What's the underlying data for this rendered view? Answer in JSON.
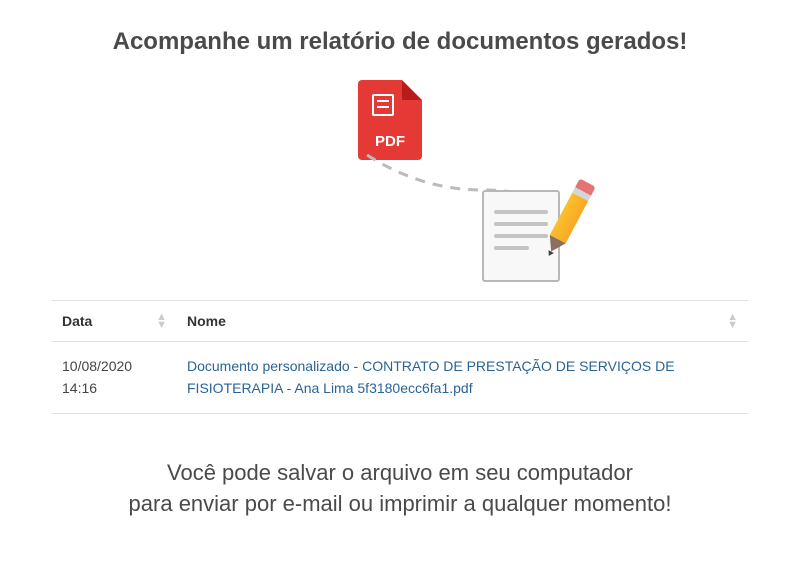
{
  "heading": "Acompanhe um relatório de documentos gerados!",
  "pdf_label": "PDF",
  "table": {
    "headers": {
      "date": "Data",
      "name": "Nome"
    },
    "rows": [
      {
        "date": "10/08/2020 14:16",
        "name": "Documento personalizado - CONTRATO DE PRESTAÇÃO DE SERVIÇOS DE FISIOTERAPIA - Ana Lima 5f3180ecc6fa1.pdf"
      }
    ]
  },
  "footer_line1": "Você pode salvar o arquivo em seu computador",
  "footer_line2": "para enviar por e-mail ou imprimir a qualquer momento!"
}
